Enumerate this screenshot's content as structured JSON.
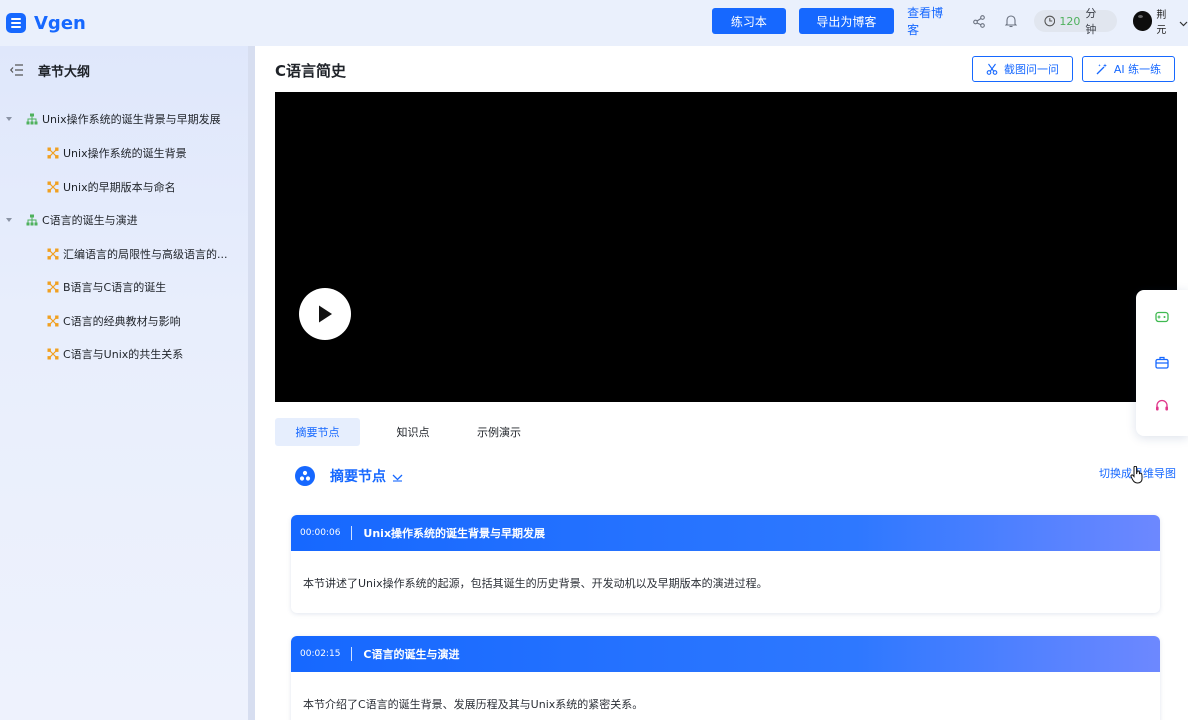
{
  "app": {
    "name": "Vgen"
  },
  "header": {
    "practice_label": "练习本",
    "export_label": "导出为博客",
    "view_blog_label": "查看博客",
    "timer_value": "120",
    "timer_unit": "分钟",
    "username": "荆元"
  },
  "sidebar": {
    "title": "章节大纲",
    "items": [
      {
        "label": "Unix操作系统的诞生背景与早期发展",
        "level": 1,
        "icon": "hierarchy-icon"
      },
      {
        "label": "Unix操作系统的诞生背景",
        "level": 2,
        "icon": "node-icon"
      },
      {
        "label": "Unix的早期版本与命名",
        "level": 2,
        "icon": "node-icon"
      },
      {
        "label": "C语言的诞生与演进",
        "level": 1,
        "icon": "hierarchy-icon"
      },
      {
        "label": "汇编语言的局限性与高级语言的...",
        "level": 2,
        "icon": "node-icon"
      },
      {
        "label": "B语言与C语言的诞生",
        "level": 2,
        "icon": "node-icon"
      },
      {
        "label": "C语言的经典教材与影响",
        "level": 2,
        "icon": "node-icon"
      },
      {
        "label": "C语言与Unix的共生关系",
        "level": 2,
        "icon": "node-icon"
      }
    ]
  },
  "main": {
    "title": "C语言简史",
    "screenshot_ask_label": "截图问一问",
    "ai_practice_label": "AI 练一练",
    "tabs": [
      "摘要节点",
      "知识点",
      "示例演示"
    ],
    "active_tab": "摘要节点",
    "section_title": "摘要节点",
    "mindmap_switch_label": "切换成思维导图",
    "cards": [
      {
        "time": "00:00:06",
        "title": "Unix操作系统的诞生背景与早期发展",
        "body": "本节讲述了Unix操作系统的起源，包括其诞生的历史背景、开发动机以及早期版本的演进过程。"
      },
      {
        "time": "00:02:15",
        "title": "C语言的诞生与演进",
        "body": "本节介绍了C语言的诞生背景、发展历程及其与Unix系统的紧密关系。"
      }
    ]
  },
  "float_panel": {
    "icons": [
      "gamepad-icon",
      "toolbox-icon",
      "headset-icon"
    ]
  },
  "colors": {
    "accent": "#1668ff",
    "tree_level1_icon": "#4fb15d",
    "tree_level2_icon": "#f0a020",
    "timer_number": "#4fb15d"
  }
}
